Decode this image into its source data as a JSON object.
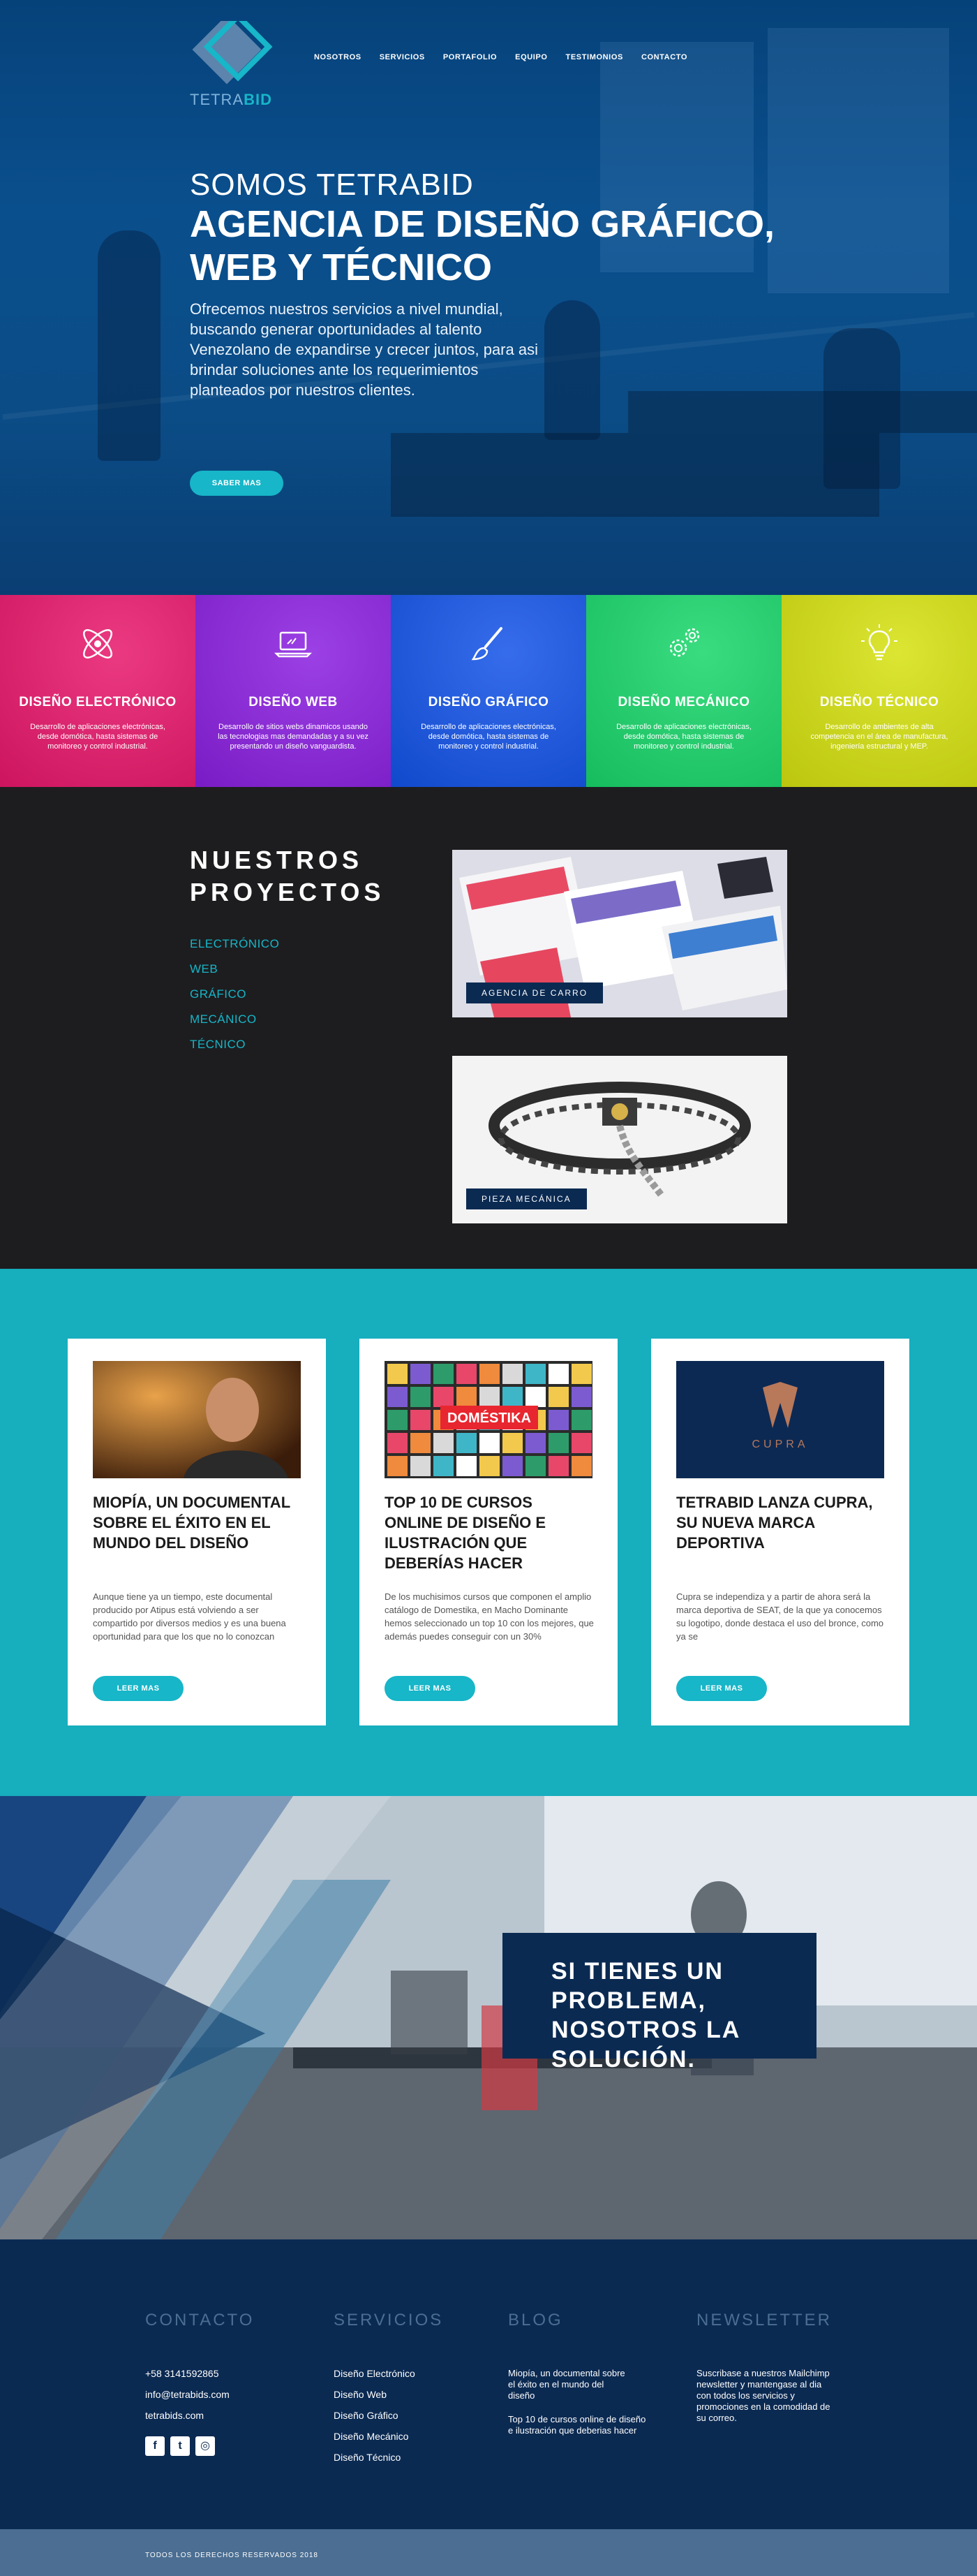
{
  "brand": {
    "logo_prefix": "TETRA",
    "logo_suffix": "BID"
  },
  "nav": [
    "NOSOTROS",
    "SERVICIOS",
    "PORTAFOLIO",
    "EQUIPO",
    "TESTIMONIOS",
    "CONTACTO"
  ],
  "hero": {
    "kicker": "SOMOS TETRABID",
    "title": "AGENCIA DE DISEÑO GRÁFICO, WEB Y TÉCNICO",
    "text": "Ofrecemos nuestros servicios a nivel mundial, buscando generar oportunidades al talento Venezolano de expandirse y crecer juntos, para asi brindar soluciones ante los requerimientos planteados por nuestros clientes.",
    "button": "SABER MAS"
  },
  "services": [
    {
      "title": "DISEÑO ELECTRÓNICO",
      "desc": "Desarrollo de aplicaciones electrónicas, desde domótica, hasta sistemas de monitoreo y control industrial.",
      "color": "#e8176b",
      "icon": "atom-icon"
    },
    {
      "title": "DISEÑO WEB",
      "desc": "Desarrollo de sitios webs dinamicos usando las tecnologias mas demandadas y a su vez presentando un diseño vanguardista.",
      "color": "#8a1fe0",
      "icon": "laptop-icon"
    },
    {
      "title": "DISEÑO GRÁFICO",
      "desc": "Desarrollo de aplicaciones electrónicas, desde domótica, hasta sistemas de monitoreo y control industrial.",
      "color": "#1353e8",
      "icon": "brush-icon"
    },
    {
      "title": "DISEÑO MECÁNICO",
      "desc": "Desarrollo de aplicaciones electrónicas, desde domótica, hasta sistemas de monitoreo y control industrial.",
      "color": "#18d66a",
      "icon": "gears-icon"
    },
    {
      "title": "DISEÑO TÉCNICO",
      "desc": "Desarrollo de ambientes de alta competencia en el área de manufactura, ingeniería estructural y MEP.",
      "color": "#d5e10f",
      "icon": "lightbulb-icon"
    }
  ],
  "projects": {
    "title": "NUESTROS PROYECTOS",
    "categories": [
      "ELECTRÓNICO",
      "WEB",
      "GRÁFICO",
      "MECÁNICO",
      "TÉCNICO"
    ],
    "items": [
      {
        "label": "AGENCIA DE CARRO"
      },
      {
        "label": "PIEZA MECÁNICA"
      }
    ]
  },
  "blog": [
    {
      "title": "MIOPÍA, UN DOCUMENTAL SOBRE EL ÉXITO EN EL MUNDO DEL DISEÑO",
      "text": "Aunque tiene ya un tiempo, este documental producido por Atipus está volviendo a ser compartido por diversos medios y es una buena oportunidad para que los que no lo conozcan",
      "button": "LEER MAS"
    },
    {
      "title": "TOP 10 DE CURSOS ONLINE DE DISEÑO E ILUSTRACIÓN QUE DEBERÍAS HACER",
      "text": "De los muchisimos cursos que componen el amplio catálogo de Domestika, en Macho Dominante hemos seleccionado un top 10 con los mejores, que además puedes conseguir con un 30%",
      "button": "LEER MAS",
      "image_text": "DOMÉSTIKA"
    },
    {
      "title": "TETRABID LANZA CUPRA, SU NUEVA MARCA DEPORTIVA",
      "text": "Cupra se independiza y a partir de ahora será la marca deportiva de SEAT, de la que ya conocemos su logotipo, donde destaca el uso del bronce, como ya se",
      "button": "LEER MAS",
      "image_text": "CUPRA"
    }
  ],
  "banner": {
    "text": "SI TIENES UN PROBLEMA, NOSOTROS LA SOLUCIÓN."
  },
  "footer": {
    "contact": {
      "heading": "CONTACTO",
      "phone": "+58 3141592865",
      "email": "info@tetrabids.com",
      "site": "tetrabids.com"
    },
    "services": {
      "heading": "SERVICIOS",
      "items": [
        "Diseño Electrónico",
        "Diseño Web",
        "Diseño Gráfico",
        "Diseño Mecánico",
        "Diseño Técnico"
      ]
    },
    "blog": {
      "heading": "BLOG",
      "items": [
        "Miopía, un documental sobre el éxito en el mundo del diseño",
        "Top 10 de cursos online de diseño e ilustración que deberias hacer"
      ]
    },
    "newsletter": {
      "heading": "NEWSLETTER",
      "text": "Suscribase a nuestros Mailchimp newsletter y mantengase al dia con todos los servicios y promociones en la comodidad de su correo."
    },
    "copyright": "TODOS LOS DERECHOS RESERVADOS 2018"
  },
  "colors": {
    "accent": "#17b6c8",
    "navy": "#0b2a52",
    "footer_heading": "#4b6e92"
  }
}
